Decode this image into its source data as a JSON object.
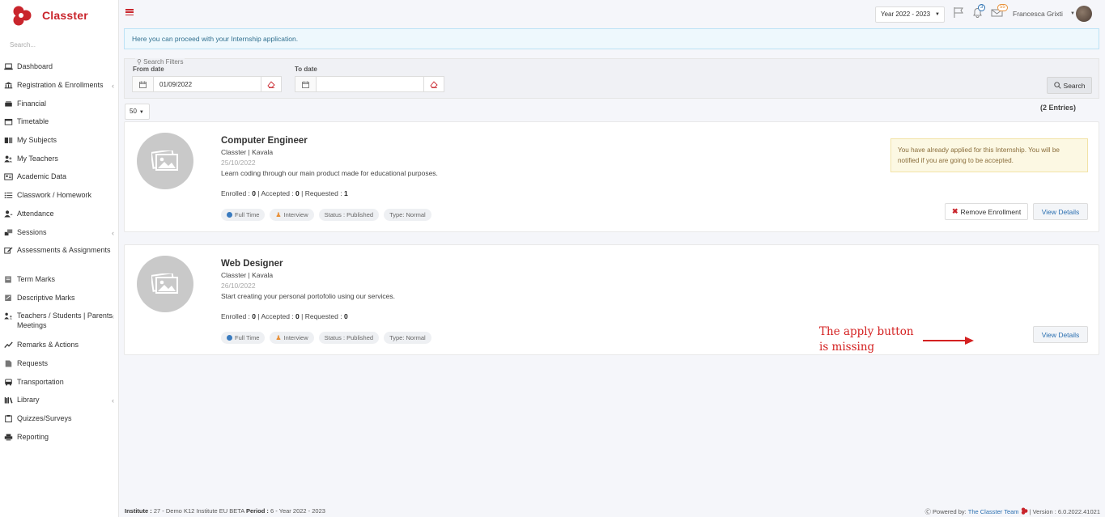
{
  "app": {
    "name": "Classter"
  },
  "sidebar": {
    "search_placeholder": "Search...",
    "items": [
      {
        "label": "Dashboard",
        "icon": "laptop-icon",
        "has_caret": false
      },
      {
        "label": "Registration & Enrollments",
        "icon": "institution-icon",
        "has_caret": true
      },
      {
        "label": "Financial",
        "icon": "money-icon",
        "has_caret": false
      },
      {
        "label": "Timetable",
        "icon": "calendar-icon",
        "has_caret": false
      },
      {
        "label": "My Subjects",
        "icon": "book-icon",
        "has_caret": false
      },
      {
        "label": "My Teachers",
        "icon": "users-icon",
        "has_caret": false
      },
      {
        "label": "Academic Data",
        "icon": "id-card-icon",
        "has_caret": false
      },
      {
        "label": "Classwork / Homework",
        "icon": "list-icon",
        "has_caret": false
      },
      {
        "label": "Attendance",
        "icon": "user-check-icon",
        "has_caret": false
      },
      {
        "label": "Sessions",
        "icon": "sessions-icon",
        "has_caret": true
      },
      {
        "label": "Assessments & Assignments",
        "icon": "edit-icon",
        "has_caret": false
      },
      {
        "label": "Term Marks",
        "icon": "file-icon",
        "has_caret": false
      },
      {
        "label": "Descriptive Marks",
        "icon": "comment-icon",
        "has_caret": false
      },
      {
        "label": "Teachers / Students | Parents Meetings",
        "icon": "meeting-icon",
        "has_caret": true
      },
      {
        "label": "Remarks & Actions",
        "icon": "trend-icon",
        "has_caret": false
      },
      {
        "label": "Requests",
        "icon": "document-icon",
        "has_caret": false
      },
      {
        "label": "Transportation",
        "icon": "bus-icon",
        "has_caret": false
      },
      {
        "label": "Library",
        "icon": "library-icon",
        "has_caret": true
      },
      {
        "label": "Quizzes/Surveys",
        "icon": "clipboard-icon",
        "has_caret": false
      },
      {
        "label": "Reporting",
        "icon": "print-icon",
        "has_caret": false
      }
    ]
  },
  "header": {
    "year": "Year 2022 - 2023",
    "notifications_count": "3",
    "messages_count": "55",
    "user_name": "Francesca Grixti"
  },
  "banner": {
    "text": "Here you can proceed with your Internship application."
  },
  "filters": {
    "legend": "Search Filters",
    "from_label": "From date",
    "from_value": "01/09/2022",
    "to_label": "To date",
    "to_value": "",
    "search_label": "Search"
  },
  "list": {
    "page_size": "50",
    "entries": "(2 Entries)"
  },
  "internships": [
    {
      "title": "Computer Engineer",
      "org": "Classter | Kavala",
      "date": "25/10/2022",
      "description": "Learn coding through our main product made for educational purposes.",
      "enrolled": "0",
      "accepted": "0",
      "requested": "1",
      "tags": [
        "Full Time",
        "Interview",
        "Status : Published",
        "Type: Normal"
      ],
      "notice": "You have already applied for this Internship. You will be notified if you are going to be accepted.",
      "remove_label": "Remove Enrollment",
      "details_label": "View Details"
    },
    {
      "title": "Web Designer",
      "org": "Classter | Kavala",
      "date": "26/10/2022",
      "description": "Start creating your personal portofolio using our services.",
      "enrolled": "0",
      "accepted": "0",
      "requested": "0",
      "tags": [
        "Full Time",
        "Interview",
        "Status : Published",
        "Type: Normal"
      ],
      "details_label": "View Details"
    }
  ],
  "stats_labels": {
    "enrolled": "Enrolled :",
    "accepted": "Accepted :",
    "requested": "Requested :"
  },
  "annotation": {
    "line1": "The apply button",
    "line2": "is missing",
    "color": "#d42121"
  },
  "footer": {
    "institute_label": "Institute :",
    "institute_value": "27 - Demo K12 Institute EU BETA",
    "period_label": "Period :",
    "period_value": "6 - Year 2022 - 2023",
    "powered_by": "Powered by:",
    "team": "The Classter Team",
    "version": "| Version : 6.0.2022.41021"
  },
  "colors": {
    "brand": "#c9252c",
    "link": "#2a6fb0"
  }
}
